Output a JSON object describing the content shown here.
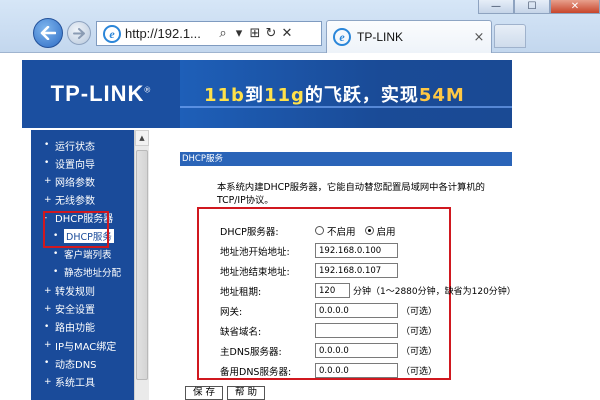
{
  "browser": {
    "window_controls": {
      "minimize": "—",
      "maximize": "☐",
      "close": "✕"
    },
    "address": "http://192.1...",
    "address_tools": [
      "⌕",
      "▾",
      "⊞",
      "↻",
      "✕"
    ],
    "tab_title": "TP-LINK",
    "tab_close": "×"
  },
  "banner": {
    "logo": "TP-LINK",
    "logo_mark": "®",
    "slogan_parts": [
      "11b",
      "到",
      "11g",
      "的飞跃，实现",
      "54M"
    ]
  },
  "sidebar": {
    "items": [
      {
        "label": "运行状态",
        "bullet": "•",
        "sub": false,
        "active": false
      },
      {
        "label": "设置向导",
        "bullet": "•",
        "sub": false,
        "active": false
      },
      {
        "label": "网络参数",
        "bullet": "+",
        "sub": false,
        "active": false
      },
      {
        "label": "无线参数",
        "bullet": "+",
        "sub": false,
        "active": false
      },
      {
        "label": "DHCP服务器",
        "bullet": "-",
        "sub": false,
        "active": false
      },
      {
        "label": "DHCP服务",
        "bullet": "•",
        "sub": true,
        "active": true
      },
      {
        "label": "客户端列表",
        "bullet": "•",
        "sub": true,
        "active": false
      },
      {
        "label": "静态地址分配",
        "bullet": "•",
        "sub": true,
        "active": false
      },
      {
        "label": "转发规则",
        "bullet": "+",
        "sub": false,
        "active": false
      },
      {
        "label": "安全设置",
        "bullet": "+",
        "sub": false,
        "active": false
      },
      {
        "label": "路由功能",
        "bullet": "•",
        "sub": false,
        "active": false
      },
      {
        "label": "IP与MAC绑定",
        "bullet": "+",
        "sub": false,
        "active": false
      },
      {
        "label": "动态DNS",
        "bullet": "•",
        "sub": false,
        "active": false
      },
      {
        "label": "系统工具",
        "bullet": "+",
        "sub": false,
        "active": false
      }
    ]
  },
  "content": {
    "section_title": "DHCP服务",
    "intro": "本系统内建DHCP服务器，它能自动替您配置局域网中各计算机的TCP/IP协议。",
    "form": {
      "dhcp_label": "DHCP服务器:",
      "option_off": "不启用",
      "option_on": "启用",
      "selected": "启用",
      "start_label": "地址池开始地址:",
      "start_value": "192.168.0.100",
      "end_label": "地址池结束地址:",
      "end_value": "192.168.0.107",
      "lease_label": "地址租期:",
      "lease_value": "120",
      "lease_note": "分钟（1～2880分钟，缺省为120分钟）",
      "gateway_label": "网关:",
      "gateway_value": "0.0.0.0",
      "optional": "（可选）",
      "domain_label": "缺省域名:",
      "domain_value": "",
      "dns1_label": "主DNS服务器:",
      "dns1_value": "0.0.0.0",
      "dns2_label": "备用DNS服务器:",
      "dns2_value": "0.0.0.0"
    },
    "buttons": {
      "save": "保 存",
      "help": "帮 助"
    }
  }
}
